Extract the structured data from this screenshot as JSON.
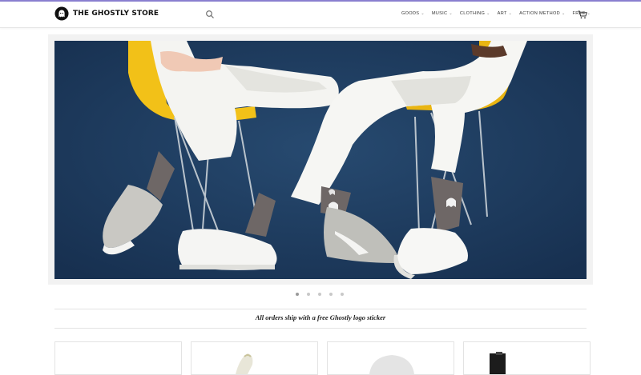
{
  "header": {
    "brand": "THE GHOSTLY STORE",
    "search_icon": "search-icon",
    "cart_icon": "cart-icon",
    "nav": [
      {
        "label": "GOODS"
      },
      {
        "label": "MUSIC"
      },
      {
        "label": "CLOTHING"
      },
      {
        "label": "ART"
      },
      {
        "label": "ACTION METHOD"
      },
      {
        "label": "FREE"
      }
    ]
  },
  "hero": {
    "slide_count": 5,
    "active_slide": 1
  },
  "promo": {
    "text": "All orders ship with a free Ghostly logo sticker"
  },
  "products": [
    {
      "id": "card-1"
    },
    {
      "id": "card-2"
    },
    {
      "id": "card-3"
    },
    {
      "id": "card-4"
    }
  ],
  "colors": {
    "accent_line": "#8a7fd0",
    "hero_bg": "#1e3a5c",
    "chair_yellow": "#f2c118"
  }
}
